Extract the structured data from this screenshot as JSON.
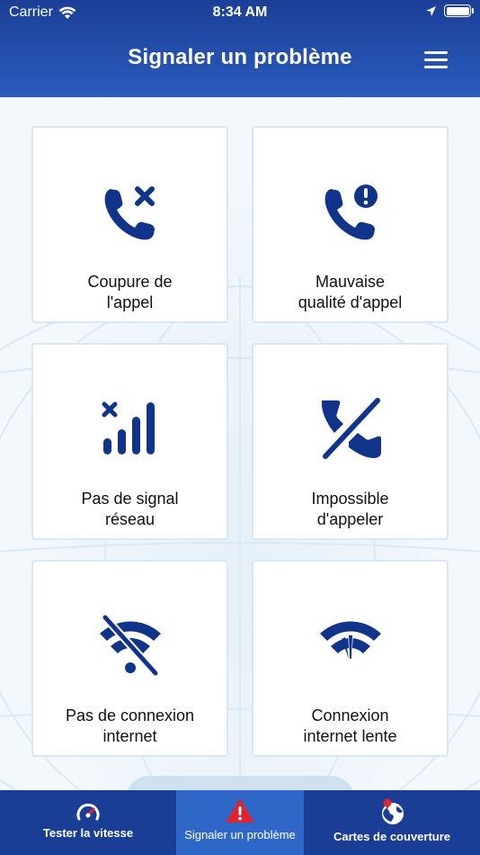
{
  "status_bar": {
    "carrier": "Carrier",
    "time": "8:34 AM"
  },
  "header": {
    "title": "Signaler un problème",
    "menu_icon": "hamburger-menu-icon"
  },
  "cards": [
    {
      "line1": "Coupure de",
      "line2": "l'appel",
      "icon": "phone-x-icon"
    },
    {
      "line1": "Mauvaise",
      "line2": "qualité d'appel",
      "icon": "phone-alert-icon"
    },
    {
      "line1": "Pas de signal",
      "line2": "réseau",
      "icon": "no-signal-bars-icon"
    },
    {
      "line1": "Impossible",
      "line2": "d'appeler",
      "icon": "phone-slash-icon"
    },
    {
      "line1": "Pas de connexion",
      "line2": "internet",
      "icon": "wifi-off-icon"
    },
    {
      "line1": "Connexion",
      "line2": "internet lente",
      "icon": "wifi-weak-icon"
    }
  ],
  "tabs": [
    {
      "label": "Tester la vitesse",
      "icon": "speedometer-icon",
      "active": false
    },
    {
      "label": "Signaler un problème",
      "icon": "warning-triangle-icon",
      "active": true
    },
    {
      "label": "Cartes de couverture",
      "icon": "globe-pin-icon",
      "active": false
    }
  ],
  "colors": {
    "header_blue": "#1b3f97",
    "icon_blue": "#10348a",
    "tab_active": "#2f67c9",
    "alert_red": "#e0242f"
  }
}
